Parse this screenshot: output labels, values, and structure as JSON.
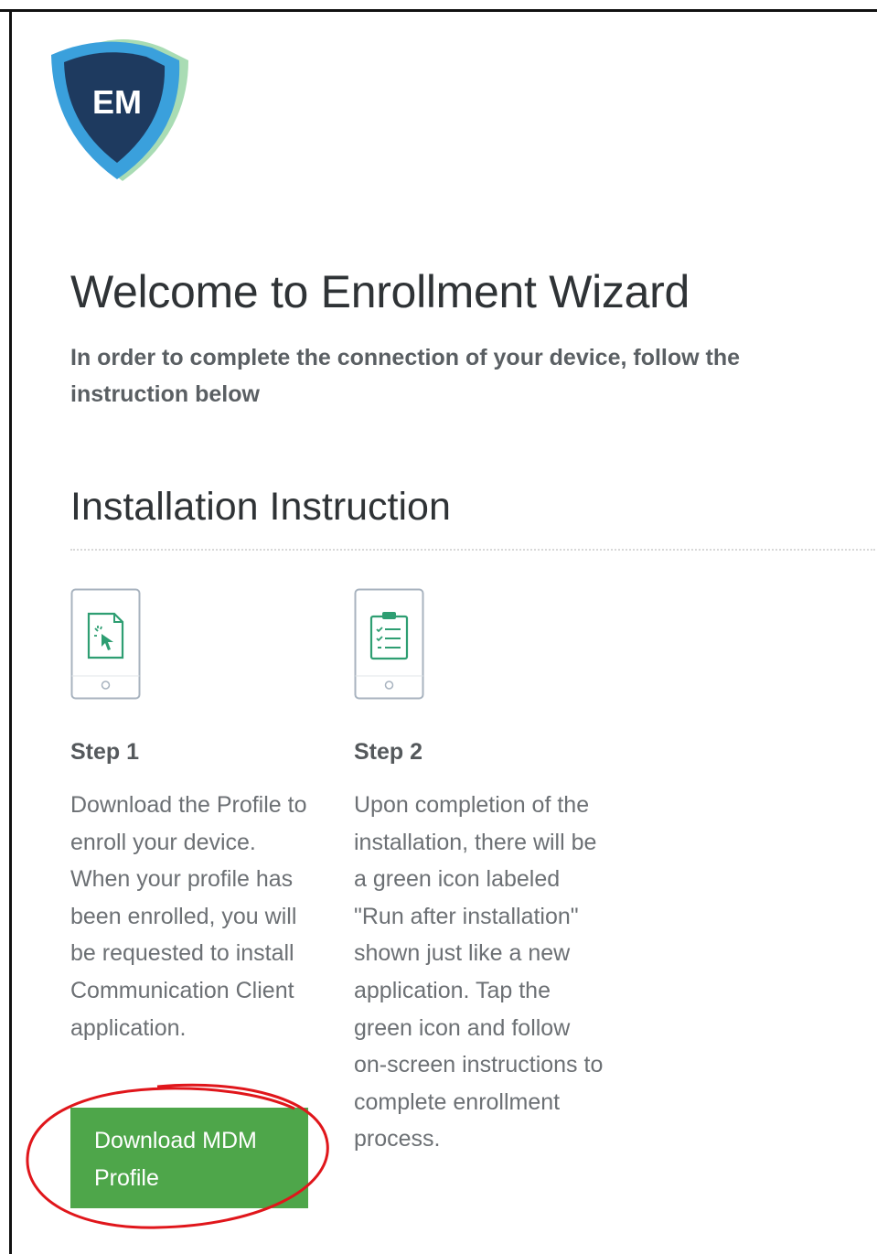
{
  "logo": {
    "text": "EM",
    "colors": {
      "outer": "#3aa0dc",
      "inner": "#1e3a5f",
      "accent": "#9fd6a8"
    }
  },
  "header": {
    "title": "Welcome to Enrollment Wizard",
    "subtitle": "In order to complete the connection of your device, follow the instruction below"
  },
  "section": {
    "title": "Installation Instruction"
  },
  "steps": [
    {
      "title": "Step 1",
      "text": "Download the Profile to enroll your device. When your profile has been enrolled, you will be requested to install Communication Client application.",
      "icon": "download-profile-phone-icon"
    },
    {
      "title": "Step 2",
      "text": "Upon completion of the installation, there will be a green icon labeled \"Run after installation\" shown just like a new application. Tap the green icon and follow on-screen instructions to complete enrollment process.",
      "icon": "clipboard-checklist-phone-icon"
    }
  ],
  "download_button": {
    "label": "Download MDM Profile",
    "color": "#4ea64a"
  },
  "annotation": {
    "color": "#e0161b"
  }
}
